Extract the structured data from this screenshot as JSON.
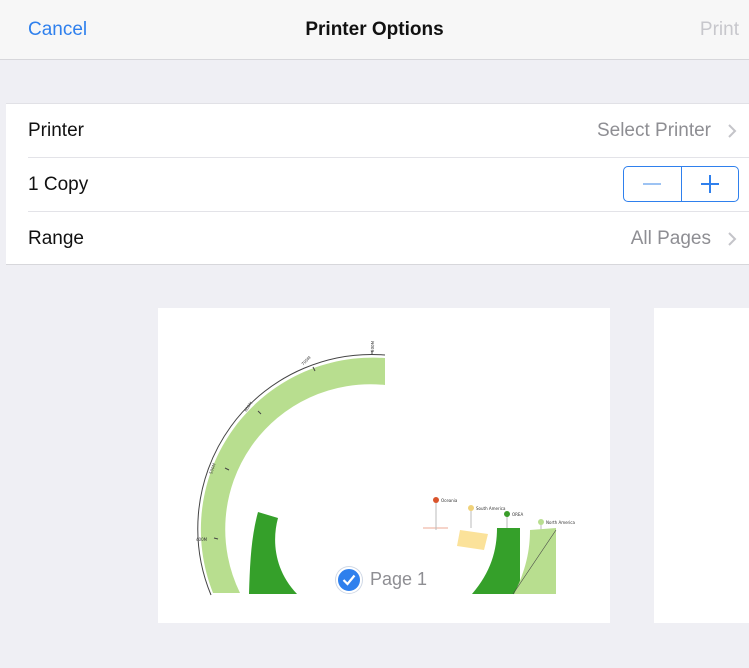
{
  "nav": {
    "cancel_label": "Cancel",
    "title": "Printer Options",
    "print_label": "Print"
  },
  "options": {
    "printer": {
      "label": "Printer",
      "value": "Select Printer"
    },
    "copies": {
      "label": "1 Copy"
    },
    "range": {
      "label": "Range",
      "value": "All Pages"
    }
  },
  "preview": {
    "page_label": "Page 1",
    "chart_data": {
      "type": "other",
      "axis_tick_labels": [
        "400M",
        "500M",
        "600M",
        "700M",
        "800M"
      ],
      "legend_labels": [
        "Oceania",
        "South America",
        "OREA",
        "North America"
      ],
      "legend_colors": [
        "#d9542c",
        "#f0d27a",
        "#3a9d2a",
        "#b8de8f"
      ]
    }
  },
  "colors": {
    "accent": "#2f80ed",
    "light_green": "#b8de8f",
    "dark_green": "#35a02a",
    "yellow": "#fbe29a"
  }
}
